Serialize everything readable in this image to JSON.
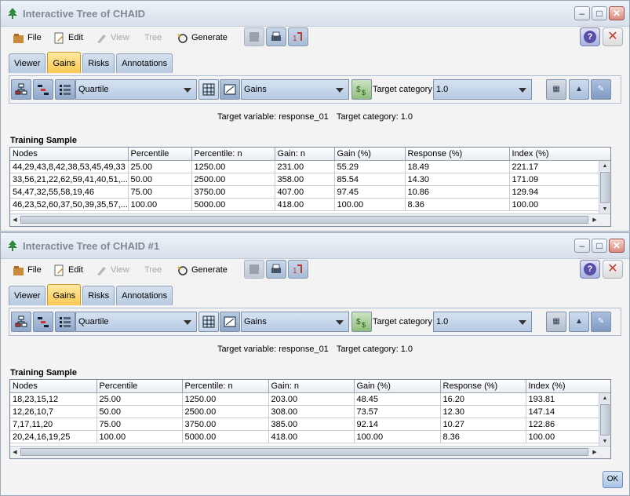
{
  "colors": {
    "accent_tab": "#f7c94f",
    "button_blue": "#a7bbd6",
    "title_text": "#7f8a96"
  },
  "windows": [
    {
      "title": "Interactive Tree of CHAID",
      "menu": {
        "file": "File",
        "edit": "Edit",
        "view": "View",
        "tree": "Tree",
        "generate": "Generate"
      },
      "tabs": [
        "Viewer",
        "Gains",
        "Risks",
        "Annotations"
      ],
      "active_tab": "Gains",
      "toolbar": {
        "grouping": "Quartile",
        "mode": "Gains",
        "target_label": "Target category",
        "target_value": "1.0"
      },
      "info": {
        "target_variable": "Target variable: response_01",
        "target_category": "Target category: 1.0"
      },
      "section_title": "Training Sample",
      "columns": [
        "Nodes",
        "Percentile",
        "Percentile: n",
        "Gain: n",
        "Gain (%)",
        "Response (%)",
        "Index (%)"
      ],
      "rows": [
        [
          "44,29,43,8,42,38,53,45,49,33",
          "25.00",
          "1250.00",
          "231.00",
          "55.29",
          "18.49",
          "221.17"
        ],
        [
          "33,56,21,22,62,59,41,40,51,...",
          "50.00",
          "2500.00",
          "358.00",
          "85.54",
          "14.30",
          "171.09"
        ],
        [
          "54,47,32,55,58,19,46",
          "75.00",
          "3750.00",
          "407.00",
          "97.45",
          "10.86",
          "129.94"
        ],
        [
          "46,23,52,60,37,50,39,35,57,...",
          "100.00",
          "5000.00",
          "418.00",
          "100.00",
          "8.36",
          "100.00"
        ]
      ]
    },
    {
      "title": "Interactive Tree of CHAID #1",
      "menu": {
        "file": "File",
        "edit": "Edit",
        "view": "View",
        "tree": "Tree",
        "generate": "Generate"
      },
      "tabs": [
        "Viewer",
        "Gains",
        "Risks",
        "Annotations"
      ],
      "active_tab": "Gains",
      "toolbar": {
        "grouping": "Quartile",
        "mode": "Gains",
        "target_label": "Target category",
        "target_value": "1.0"
      },
      "info": {
        "target_variable": "Target variable: response_01",
        "target_category": "Target category: 1.0"
      },
      "section_title": "Training Sample",
      "columns": [
        "Nodes",
        "Percentile",
        "Percentile: n",
        "Gain: n",
        "Gain (%)",
        "Response (%)",
        "Index (%)"
      ],
      "rows": [
        [
          "18,23,15,12",
          "25.00",
          "1250.00",
          "203.00",
          "48.45",
          "16.20",
          "193.81"
        ],
        [
          "12,26,10,7",
          "50.00",
          "2500.00",
          "308.00",
          "73.57",
          "12.30",
          "147.14"
        ],
        [
          "7,17,11,20",
          "75.00",
          "3750.00",
          "385.00",
          "92.14",
          "10.27",
          "122.86"
        ],
        [
          "20,24,16,19,25",
          "100.00",
          "5000.00",
          "418.00",
          "100.00",
          "8.36",
          "100.00"
        ]
      ],
      "ok_label": "OK"
    }
  ]
}
